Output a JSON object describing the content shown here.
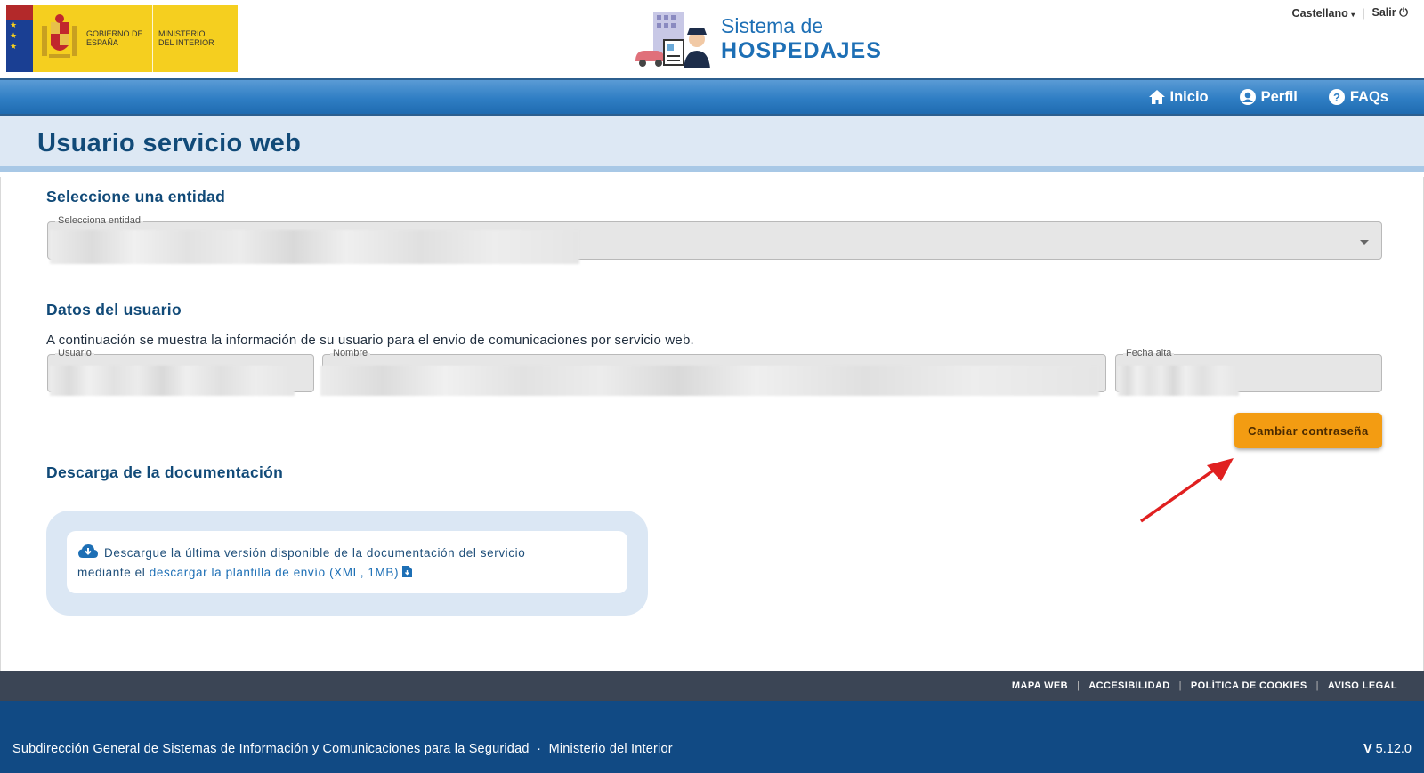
{
  "header": {
    "gov_logo_text_1": "Gobierno de España",
    "gov_logo_text_2": "Ministerio del Interior",
    "brand_line1": "Sistema de",
    "brand_line2": "HOSPEDAJES",
    "language": "Castellano",
    "logout": "Salir"
  },
  "nav": {
    "items": [
      {
        "label": "Inicio",
        "icon": "home-icon"
      },
      {
        "label": "Perfil",
        "icon": "user-circle-icon"
      },
      {
        "label": "FAQs",
        "icon": "question-circle-icon"
      }
    ]
  },
  "page": {
    "title": "Usuario servicio web"
  },
  "entity": {
    "section_title": "Seleccione una entidad",
    "legend": "Selecciona entidad"
  },
  "user": {
    "section_title": "Datos del usuario",
    "description": "A continuación se muestra la información de su usuario para el envio de comunicaciones por servicio web.",
    "fields": {
      "usuario_legend": "Usuario",
      "nombre_legend": "Nombre",
      "fecha_legend": "Fecha alta"
    },
    "change_password": "Cambiar contraseña"
  },
  "docs": {
    "section_title": "Descarga de la documentación",
    "text_1": "Descargue la última versión disponible de la documentación del servicio",
    "text_2": "mediante el",
    "link": "descargar la plantilla de envío (XML, 1MB)"
  },
  "footer": {
    "links": [
      "MAPA WEB",
      "ACCESIBILIDAD",
      "POLÍTICA DE COOKIES",
      "AVISO LEGAL"
    ],
    "org_1": "Subdirección General de Sistemas de Información y Comunicaciones para la Seguridad",
    "org_sep": "·",
    "org_2": "Ministerio del Interior",
    "version_prefix": "V",
    "version": "5.12.0"
  },
  "colors": {
    "primary_blue": "#114a78",
    "nav_blue": "#2f7ec4",
    "accent_orange": "#f39c12",
    "footer_dark": "#3b4555",
    "footer_blue": "#114a84"
  }
}
